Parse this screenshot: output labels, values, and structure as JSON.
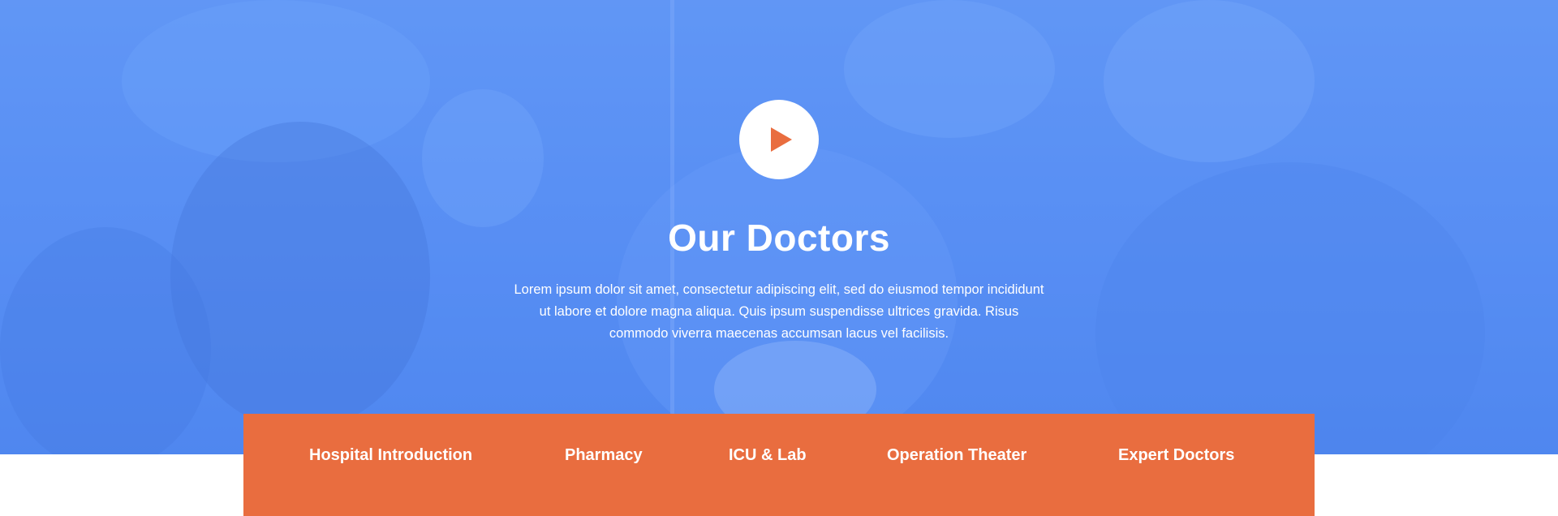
{
  "hero": {
    "title": "Our Doctors",
    "description": "Lorem ipsum dolor sit amet, consectetur adipiscing elit, sed do eiusmod tempor incididunt ut labore et dolore magna aliqua. Quis ipsum suspendisse ultrices gravida. Risus commodo viverra maecenas accumsan lacus vel facilisis.",
    "overlay_color": "#5b8ff2",
    "play_icon": "play-icon",
    "play_icon_color": "#e96d3f"
  },
  "tabs": {
    "background_color": "#e96d3f",
    "active_indicator_color": "#4a7bea",
    "active_index": 0,
    "items": [
      {
        "label": "Hospital Introduction"
      },
      {
        "label": "Pharmacy"
      },
      {
        "label": "ICU & Lab"
      },
      {
        "label": "Operation Theater"
      },
      {
        "label": "Expert Doctors"
      }
    ]
  }
}
